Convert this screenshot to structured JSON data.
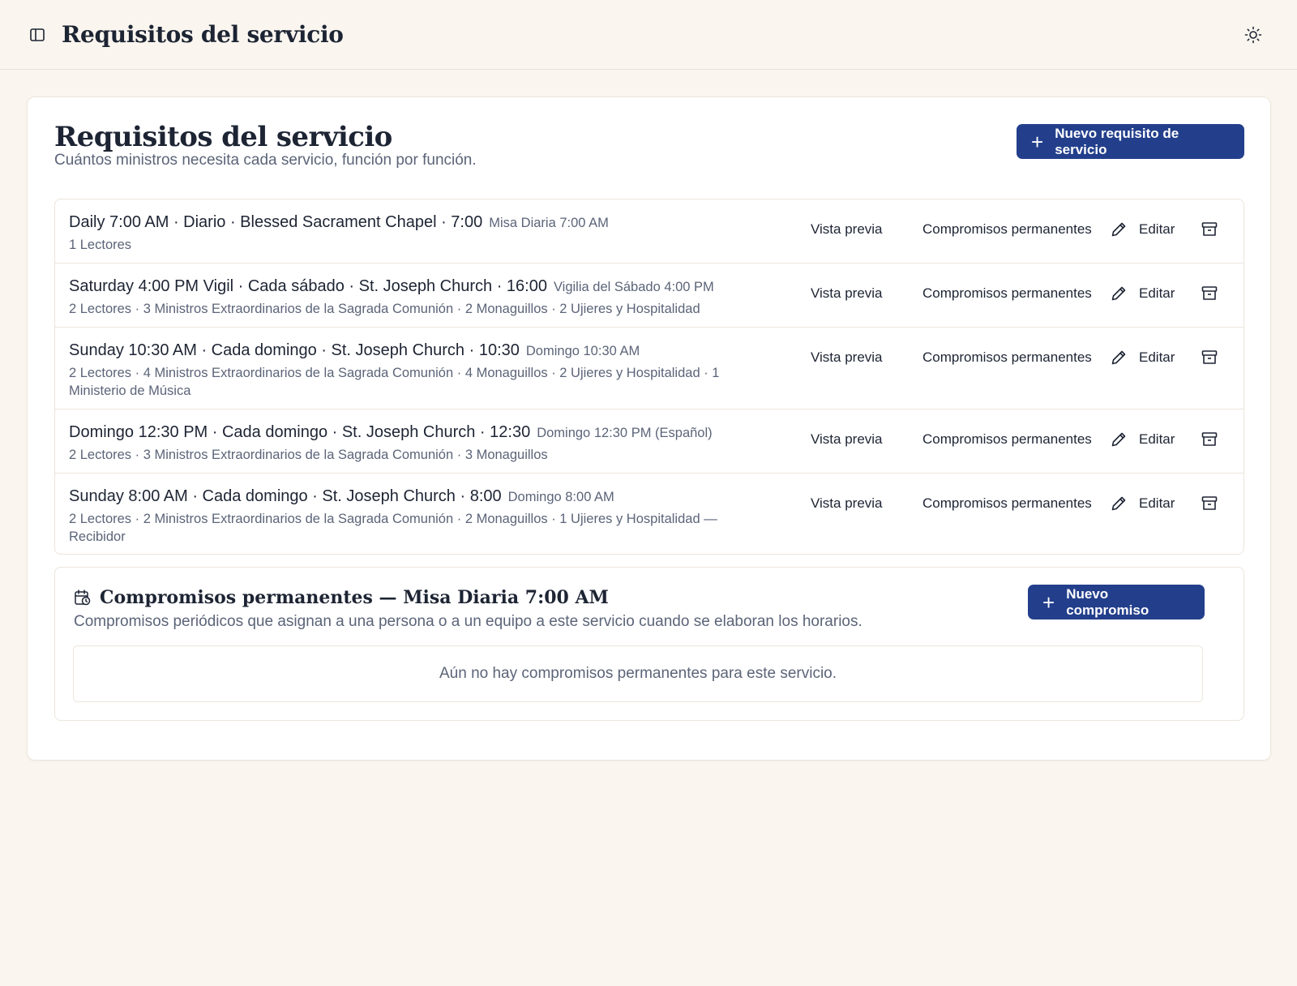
{
  "header": {
    "title": "Requisitos del servicio",
    "sidebar_icon": "sidebar-panel-icon",
    "theme_icon": "sun-icon"
  },
  "page": {
    "title": "Requisitos del servicio",
    "subtitle": "Cuántos ministros necesita cada servicio, función por función.",
    "new_button_label": "Nuevo requisito de servicio"
  },
  "actions": {
    "preview_label": "Vista previa",
    "commitments_label": "Compromisos permanentes",
    "edit_label": "Editar"
  },
  "services": [
    {
      "title": "Daily 7:00 AM · Diario · Blessed Sacrament Chapel · 7:00",
      "alias": "Misa Diaria 7:00 AM",
      "details": "1 Lectores"
    },
    {
      "title": "Saturday 4:00 PM Vigil · Cada sábado · St. Joseph Church · 16:00",
      "alias": "Vigilia del Sábado 4:00 PM",
      "details": "2 Lectores · 3 Ministros Extraordinarios de la Sagrada Comunión · 2 Monaguillos · 2 Ujieres y Hospitalidad"
    },
    {
      "title": "Sunday 10:30 AM · Cada domingo · St. Joseph Church · 10:30",
      "alias": "Domingo 10:30 AM",
      "details": "2 Lectores · 4 Ministros Extraordinarios de la Sagrada Comunión · 4 Monaguillos · 2 Ujieres y Hospitalidad · 1 Ministerio de Música"
    },
    {
      "title": "Domingo 12:30 PM · Cada domingo · St. Joseph Church · 12:30",
      "alias": "Domingo 12:30 PM (Español)",
      "details": "2 Lectores · 3 Ministros Extraordinarios de la Sagrada Comunión · 3 Monaguillos"
    },
    {
      "title": "Sunday 8:00 AM · Cada domingo · St. Joseph Church · 8:00",
      "alias": "Domingo 8:00 AM",
      "details": "2 Lectores · 2 Ministros Extraordinarios de la Sagrada Comunión · 2 Monaguillos · 1 Ujieres y Hospitalidad — Recibidor"
    }
  ],
  "commitments": {
    "title": "Compromisos permanentes — Misa Diaria 7:00 AM",
    "description": "Compromisos periódicos que asignan a una persona o a un equipo a este servicio cuando se elaboran los horarios.",
    "new_button_label": "Nuevo compromiso",
    "empty_message": "Aún no hay compromisos permanentes para este servicio.",
    "icon": "calendar-clock-icon"
  },
  "colors": {
    "background": "#faf6ef",
    "accent": "#233f8c",
    "text": "#1d2433",
    "muted": "#5b6478"
  }
}
